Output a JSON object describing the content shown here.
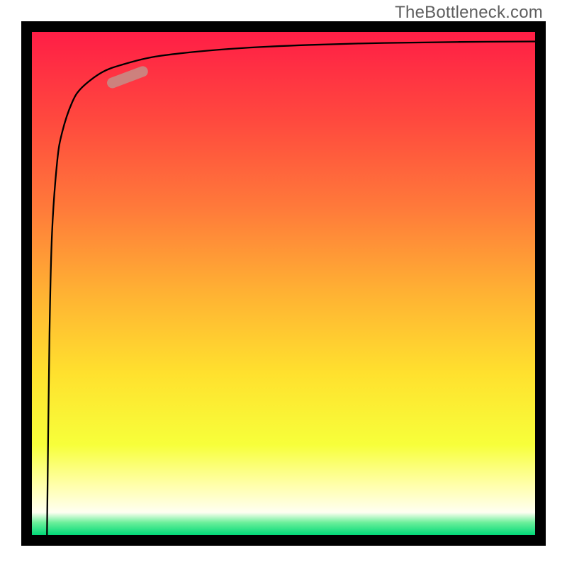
{
  "watermark": {
    "text": "TheBottleneck.com"
  },
  "chart_data": {
    "type": "line",
    "title": "",
    "xlabel": "",
    "ylabel": "",
    "xlim": [
      0,
      100
    ],
    "ylim": [
      0,
      100
    ],
    "series": [
      {
        "name": "curve",
        "x": [
          3,
          3.5,
          4,
          5,
          6,
          8,
          10,
          14,
          18,
          24,
          32,
          42,
          55,
          70,
          85,
          100
        ],
        "y": [
          0,
          40,
          60,
          74,
          80,
          86,
          89,
          92,
          93.5,
          95,
          96,
          96.8,
          97.4,
          97.8,
          98,
          98.1
        ]
      }
    ],
    "gradient_stops": [
      {
        "offset": 0.0,
        "color": "#FF1E46"
      },
      {
        "offset": 0.18,
        "color": "#FF4A3E"
      },
      {
        "offset": 0.35,
        "color": "#FF7A3A"
      },
      {
        "offset": 0.52,
        "color": "#FFB233"
      },
      {
        "offset": 0.68,
        "color": "#FFE12E"
      },
      {
        "offset": 0.82,
        "color": "#F7FF3A"
      },
      {
        "offset": 0.9,
        "color": "#FFFFAA"
      },
      {
        "offset": 0.955,
        "color": "#FFFFF2"
      },
      {
        "offset": 0.975,
        "color": "#6BEF9A"
      },
      {
        "offset": 1.0,
        "color": "#00D977"
      }
    ],
    "marker": {
      "x_range": [
        15,
        23
      ],
      "y_range": [
        89.5,
        92.5
      ],
      "color": "#C88A84",
      "style": "capsule"
    },
    "curve_color": "#000000",
    "curve_width": 2.3
  }
}
